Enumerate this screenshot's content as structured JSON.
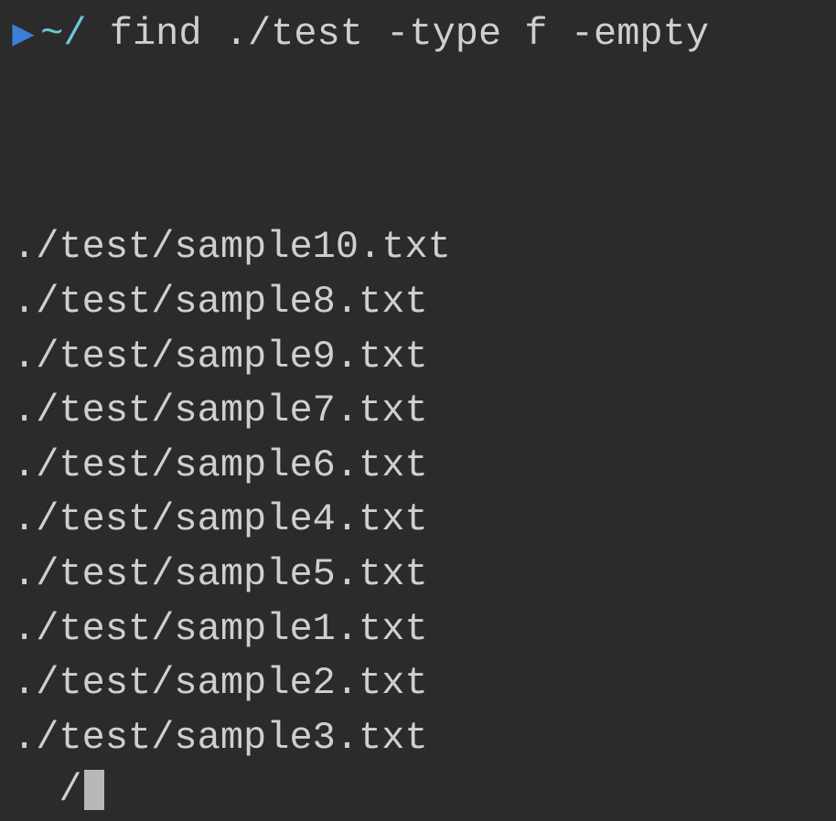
{
  "prompt": {
    "icon": "apple-icon",
    "path": "~/",
    "command": "find ./test -type f -empty"
  },
  "output": [
    "./test/sample10.txt",
    "./test/sample8.txt",
    "./test/sample9.txt",
    "./test/sample7.txt",
    "./test/sample6.txt",
    "./test/sample4.txt",
    "./test/sample5.txt",
    "./test/sample1.txt",
    "./test/sample2.txt",
    "./test/sample3.txt"
  ],
  "cursor_prefix": "  /"
}
